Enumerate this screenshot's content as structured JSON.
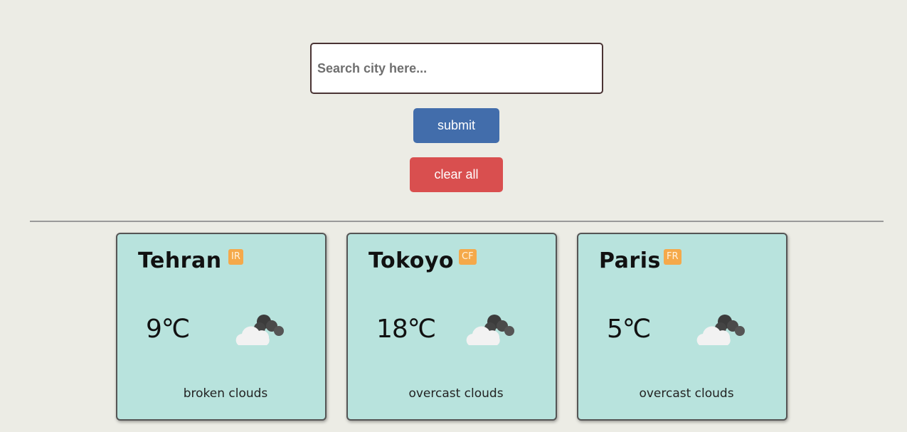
{
  "search": {
    "placeholder": "Search city here...",
    "value": ""
  },
  "buttons": {
    "submit_label": "submit",
    "clear_label": "clear all"
  },
  "colors": {
    "background": "#ecece5",
    "submit": "#426dab",
    "clear": "#d94f4f",
    "card": "#b8e3dd",
    "badge": "#f5a94a"
  },
  "cards": [
    {
      "city": "Tehran",
      "country": "IR",
      "temperature": "9℃",
      "icon": "broken-clouds-icon",
      "description": "broken clouds"
    },
    {
      "city": "Tokoyo",
      "country": "CF",
      "temperature": "18℃",
      "icon": "overcast-clouds-icon",
      "description": "overcast clouds"
    },
    {
      "city": "Paris",
      "country": "FR",
      "temperature": "5℃",
      "icon": "overcast-clouds-icon",
      "description": "overcast clouds"
    }
  ]
}
